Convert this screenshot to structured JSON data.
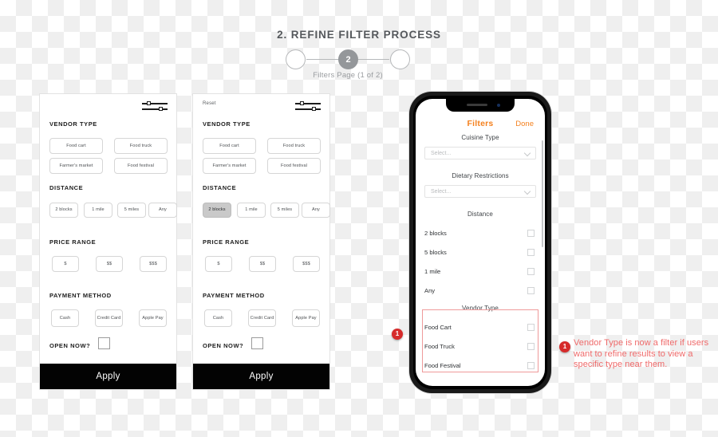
{
  "header": {
    "title": "2. REFINE FILTER PROCESS",
    "progress": {
      "current_step": "2",
      "caption": "Filters Page (1 of 2)",
      "total_steps": 3
    }
  },
  "wireframe_panels": [
    {
      "id": "panel-1",
      "reset_label": "",
      "sections": {
        "vendor_type": {
          "title": "VENDOR TYPE",
          "options": [
            "Food cart",
            "Food truck",
            "Farmer's market",
            "Food festival"
          ],
          "selected": null
        },
        "distance": {
          "title": "DISTANCE",
          "options": [
            "2 blocks",
            "1 mile",
            "5 miles",
            "Any"
          ],
          "selected": null
        },
        "price_range": {
          "title": "PRICE RANGE",
          "options": [
            "$",
            "$$",
            "$$$"
          ],
          "selected": null
        },
        "payment_method": {
          "title": "PAYMENT METHOD",
          "options": [
            "Cash",
            "Credit Card",
            "Apple Pay"
          ],
          "selected": null
        },
        "open_now": {
          "title": "OPEN NOW?",
          "checked": false
        }
      },
      "apply_label": "Apply"
    },
    {
      "id": "panel-2",
      "reset_label": "Reset",
      "sections": {
        "vendor_type": {
          "title": "VENDOR TYPE",
          "options": [
            "Food cart",
            "Food truck",
            "Farmer's market",
            "Food festival"
          ],
          "selected": null
        },
        "distance": {
          "title": "DISTANCE",
          "options": [
            "2 blocks",
            "1 mile",
            "5 miles",
            "Any"
          ],
          "selected": "2 blocks"
        },
        "price_range": {
          "title": "PRICE RANGE",
          "options": [
            "$",
            "$$",
            "$$$"
          ],
          "selected": null
        },
        "payment_method": {
          "title": "PAYMENT METHOD",
          "options": [
            "Cash",
            "Credit Card",
            "Apple Pay"
          ],
          "selected": null
        },
        "open_now": {
          "title": "OPEN NOW?",
          "checked": false
        }
      },
      "apply_label": "Apply"
    }
  ],
  "phone": {
    "nav": {
      "title": "Filters",
      "done_label": "Done"
    },
    "fields": [
      {
        "label": "Cuisine Type",
        "type": "select",
        "placeholder": "Select..."
      },
      {
        "label": "Dietary Restrictions",
        "type": "select",
        "placeholder": "Select..."
      }
    ],
    "distance": {
      "label": "Distance",
      "options": [
        {
          "label": "2 blocks",
          "checked": false
        },
        {
          "label": "5 blocks",
          "checked": false
        },
        {
          "label": "1 mile",
          "checked": false
        },
        {
          "label": "Any",
          "checked": false
        }
      ]
    },
    "vendor_type": {
      "label": "Vendor Type",
      "highlighted": true,
      "options": [
        {
          "label": "Food Cart",
          "checked": false
        },
        {
          "label": "Food Truck",
          "checked": false
        },
        {
          "label": "Food Festival",
          "checked": false
        }
      ]
    }
  },
  "annotations": [
    {
      "number": "1",
      "text": "Vendor Type is now a filter if users want to refine results to view a specific type near them."
    }
  ],
  "colors": {
    "brand_orange": "#f4811f",
    "annotation_red": "#ef6a6a",
    "badge_red": "#d62b2b",
    "highlight_border": "#ef9a9a",
    "apply_bar": "#030303",
    "step_active": "#94979a"
  }
}
